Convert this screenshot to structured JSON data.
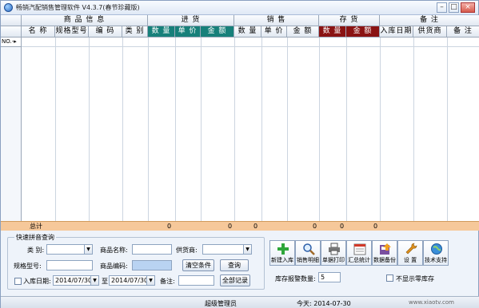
{
  "window": {
    "title": "畅销汽配销售管理软件 V4.3.7(春节珍藏版)",
    "min": "–",
    "max": "□",
    "close": "×"
  },
  "grid": {
    "groups": [
      "商 品 信 息",
      "进 货",
      "销 售",
      "存 货",
      "备 注"
    ],
    "columns": [
      "名 称",
      "规格型号",
      "编 码",
      "类 别",
      "数 量",
      "单 价",
      "金 额",
      "数 量",
      "单 价",
      "金 额",
      "数 量",
      "金 额",
      "入库日期",
      "供货商",
      "备 注"
    ],
    "row_marker": "NO.-▸",
    "totals_label": "总计",
    "totals_values": [
      "0",
      "0",
      "0",
      "0",
      "0",
      "0",
      "0"
    ]
  },
  "search": {
    "title": "快速拼音查询",
    "category_label": "类 别:",
    "product_name_label": "商品名称:",
    "supplier_label": "供货商:",
    "spec_label": "规格型号:",
    "product_code_label": "商品编码:",
    "clear_button": "清空条件",
    "query_button": "查询",
    "in_date_label": "入库日期:",
    "date_from": "2014/07/30",
    "to_label": "至",
    "date_to": "2014/07/30",
    "note_label": "备注:",
    "all_records_button": "全部记录"
  },
  "toolbar": {
    "buttons": [
      "新建入库",
      "销售明细",
      "单据打印",
      "汇总统计",
      "数据备份",
      "设 置",
      "技术支持"
    ]
  },
  "alarm": {
    "label": "库存报警数量:",
    "value": "5",
    "hide_zero_label": "不显示零库存"
  },
  "status": {
    "user": "超级管理员",
    "today": "今天: 2014-07-30",
    "watermark": "www.xiaotv.com"
  },
  "colors": {
    "teal": "#17807a",
    "maroon": "#8a1313",
    "totals_bg": "#f6c89a"
  }
}
